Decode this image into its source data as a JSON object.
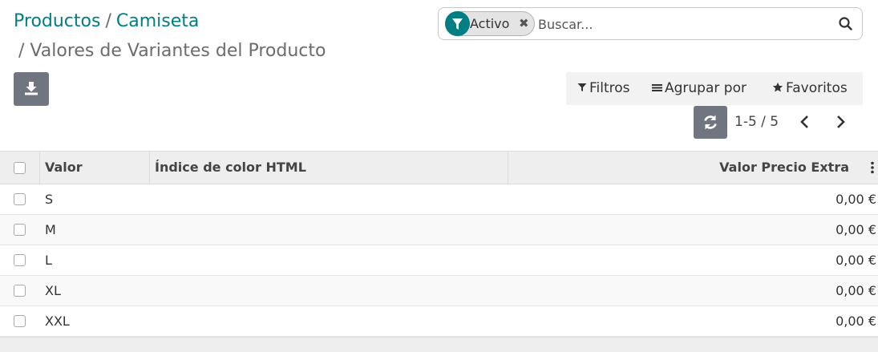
{
  "breadcrumb": {
    "items": [
      "Productos",
      "Camiseta"
    ],
    "current": "Valores de Variantes del Producto",
    "separator": "/"
  },
  "search": {
    "facet_label": "Activo",
    "facet_remove": "✖",
    "placeholder": "Buscar..."
  },
  "toolbar": {
    "filters_label": "Filtros",
    "group_by_label": "Agrupar por",
    "favorites_label": "Favoritos"
  },
  "pager": {
    "value": "1-5 / 5"
  },
  "table": {
    "columns": [
      "Valor",
      "Índice de color HTML",
      "Valor Precio Extra"
    ],
    "rows": [
      {
        "valor": "S",
        "color": "",
        "precio": "0,00 €"
      },
      {
        "valor": "M",
        "color": "",
        "precio": "0,00 €"
      },
      {
        "valor": "L",
        "color": "",
        "precio": "0,00 €"
      },
      {
        "valor": "XL",
        "color": "",
        "precio": "0,00 €"
      },
      {
        "valor": "XXL",
        "color": "",
        "precio": "0,00 €"
      }
    ]
  },
  "colors": {
    "link": "#017e84",
    "button": "#71757f",
    "header_bg": "#eeeeee"
  },
  "icons": {
    "facet": "filter-icon",
    "search": "search-icon",
    "download": "download-icon",
    "filters": "filter-icon",
    "group_by": "list-icon",
    "favorites": "star-icon",
    "refresh": "refresh-icon",
    "prev": "chevron-left-icon",
    "next": "chevron-right-icon",
    "optional_columns": "vertical-ellipsis-icon"
  }
}
